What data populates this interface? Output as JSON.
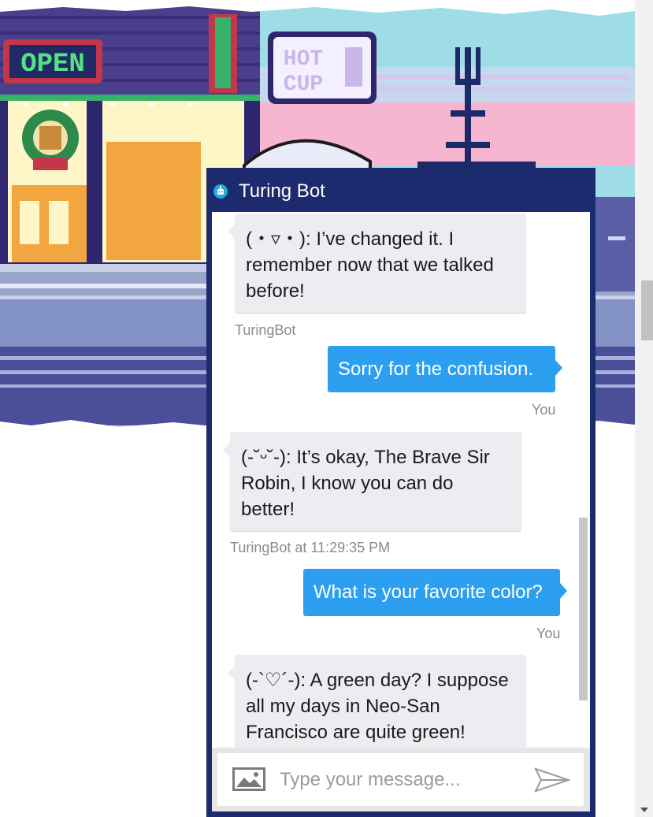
{
  "banner": {
    "open_sign": "OPEN",
    "cafe_sign_line1": "HOT",
    "cafe_sign_line2": "CUP"
  },
  "chat": {
    "title": "Turing Bot",
    "messages": [
      {
        "from": "bot",
        "text": "(・▿・): I’ve changed it. I remember now that we talked before!",
        "lines": [
          "(・▿・): I’ve changed it. I",
          "remember now that we talked",
          "before!"
        ],
        "meta": "TuringBot"
      },
      {
        "from": "user",
        "text": "Sorry for the confusion.",
        "meta": "You"
      },
      {
        "from": "bot",
        "text": "(-˘ᵕ˘-): It’s okay, The Brave Sir Robin, I know you can do better!",
        "lines": [
          "(-˘ᵕ˘-): It’s okay, The Brave Sir",
          "Robin, I know you can do",
          "better!"
        ],
        "meta": "TuringBot at 11:29:35 PM"
      },
      {
        "from": "user",
        "text": "What is your favorite color?",
        "meta": "You"
      },
      {
        "from": "bot",
        "text": "(-`♡´-): A green day? I suppose all my days in Neo-San Francisco are quite green!",
        "lines": [
          "(-`♡´-): A green day? I suppose",
          "all my days in Neo-San",
          "Francisco are quite green!"
        ],
        "meta": ""
      }
    ],
    "input": {
      "placeholder": "Type your message...",
      "value": ""
    },
    "colors": {
      "frame": "#1b2b6d",
      "user_bubble": "#2d9ff0",
      "bot_bubble": "#ebedf0"
    }
  }
}
